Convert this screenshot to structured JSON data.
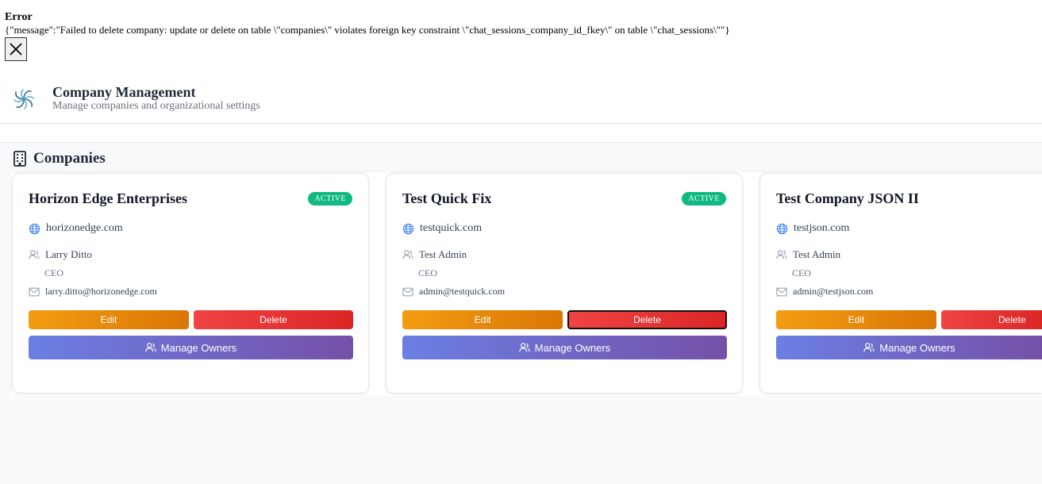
{
  "error": {
    "title": "Error",
    "message": "{\"message\":\"Failed to delete company: update or delete on table \\\"companies\\\" violates foreign key constraint \\\"chat_sessions_company_id_fkey\\\" on table \\\"chat_sessions\\\"\"}",
    "close_icon": "close-icon"
  },
  "header": {
    "title": "Company Management",
    "subtitle": "Manage companies and organizational settings",
    "logo_icon": "pinwheel-logo-icon"
  },
  "companies": {
    "section_title": "Companies",
    "section_icon": "building-icon",
    "items": [
      {
        "name": "Horizon Edge Enterprises",
        "status": "ACTIVE",
        "domain": "horizonedge.com",
        "owner_name": "Larry Ditto",
        "owner_role": "CEO",
        "owner_email": "larry.ditto@horizonedge.com",
        "edit_label": "Edit",
        "delete_label": "Delete",
        "owners_label": "Manage Owners"
      },
      {
        "name": "Test Quick Fix",
        "status": "ACTIVE",
        "domain": "testquick.com",
        "owner_name": "Test Admin",
        "owner_role": "CEO",
        "owner_email": "admin@testquick.com",
        "edit_label": "Edit",
        "delete_label": "Delete",
        "owners_label": "Manage Owners"
      },
      {
        "name": "Test Company JSON II",
        "status": "",
        "domain": "testjson.com",
        "owner_name": "Test Admin",
        "owner_role": "CEO",
        "owner_email": "admin@testjson.com",
        "edit_label": "Edit",
        "delete_label": "Delete",
        "owners_label": "Manage Owners"
      }
    ]
  },
  "colors": {
    "active_badge": "#10b981",
    "edit_button": "#f39c12",
    "delete_button": "#ef4444",
    "owners_button": "#6b7fe3"
  }
}
